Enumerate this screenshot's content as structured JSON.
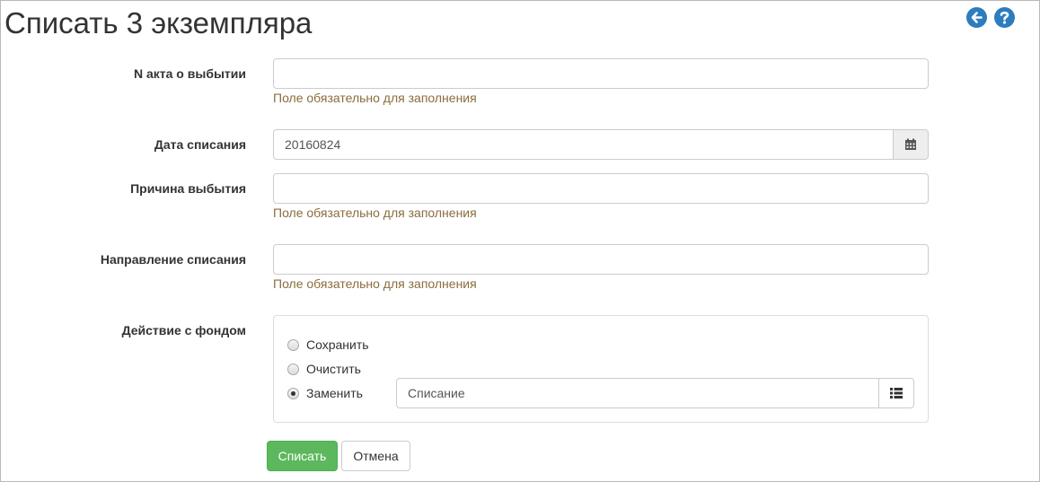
{
  "page": {
    "title": "Списать 3 экземпляра",
    "icons": {
      "back": "arrow-left-circle-icon",
      "help": "question-circle-icon",
      "accent": "#2d7cbf"
    }
  },
  "form": {
    "act_number": {
      "label": "N акта о выбытии",
      "value": "",
      "help": "Поле обязательно для заполнения"
    },
    "write_off_date": {
      "label": "Дата списания",
      "value": "20160824",
      "icon": "calendar-icon"
    },
    "reason": {
      "label": "Причина выбытия",
      "value": "",
      "help": "Поле обязательно для заполнения"
    },
    "direction": {
      "label": "Направление списания",
      "value": "",
      "help": "Поле обязательно для заполнения"
    },
    "fund_action": {
      "label": "Действие с фондом",
      "options": [
        {
          "label": "Сохранить",
          "checked": false
        },
        {
          "label": "Очистить",
          "checked": false
        },
        {
          "label": "Заменить",
          "checked": true
        }
      ],
      "replace_value": "Списание",
      "replace_icon": "list-icon"
    }
  },
  "actions": {
    "submit_label": "Списать",
    "cancel_label": "Отмена",
    "submit_color": "#5cb85c"
  },
  "colors": {
    "help_text": "#8a6d3b"
  }
}
